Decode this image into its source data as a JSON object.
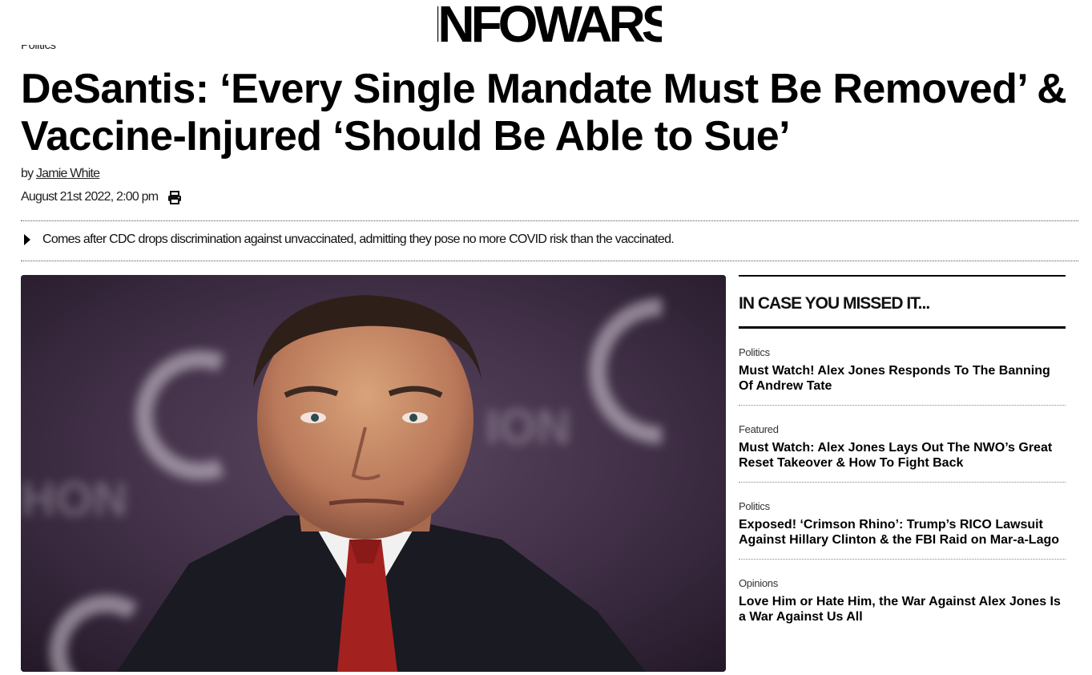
{
  "site": {
    "logo_text": "INFOWARS"
  },
  "article": {
    "category": "Politics",
    "headline": "DeSantis: ‘Every Single Mandate Must Be Removed’ & Vaccine-Injured ‘Should Be Able to Sue’",
    "byline_prefix": "by",
    "author": "Jamie White",
    "date": "August 21st 2022, 2:00 pm",
    "print_icon": "print-icon",
    "summary": "Comes after CDC drops discrimination against unvaccinated, admitting they pose no more COVID risk than the vaccinated."
  },
  "sidebar": {
    "heading": "IN CASE YOU MISSED IT...",
    "items": [
      {
        "category": "Politics",
        "title": "Must Watch! Alex Jones Responds To The Banning Of Andrew Tate"
      },
      {
        "category": "Featured",
        "title": "Must Watch: Alex Jones Lays Out The NWO’s Great Reset Takeover & How To Fight Back"
      },
      {
        "category": "Politics",
        "title": "Exposed! ‘Crimson Rhino’: Trump’s RICO Lawsuit Against Hillary Clinton & the FBI Raid on Mar-a-Lago"
      },
      {
        "category": "Opinions",
        "title": "Love Him or Hate Him, the War Against Alex Jones Is a War Against Us All"
      }
    ]
  }
}
